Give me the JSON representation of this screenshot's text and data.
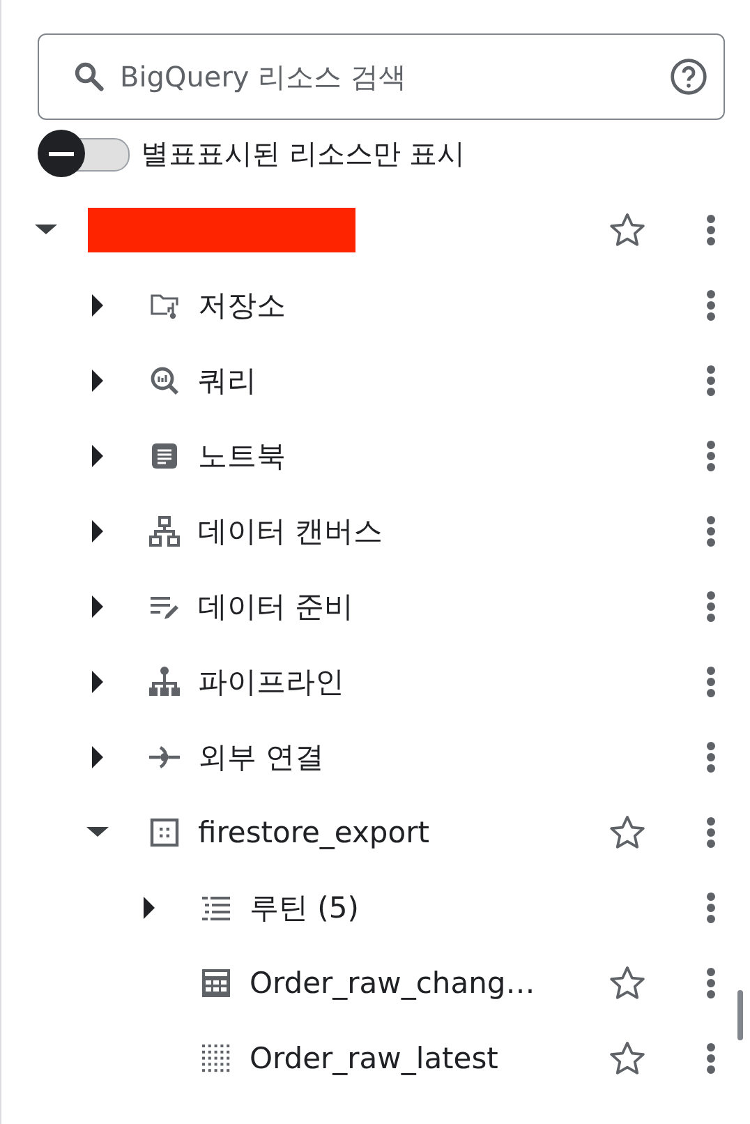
{
  "search": {
    "placeholder": "BigQuery 리소스 검색"
  },
  "starred_filter": {
    "label": "별표표시된 리소스만 표시",
    "on": false
  },
  "tree": [
    {
      "redacted": true,
      "expanded": true,
      "starred": false,
      "children": [
        {
          "label": "저장소",
          "kind": "repository",
          "expanded": false
        },
        {
          "label": "쿼리",
          "kind": "query",
          "expanded": false
        },
        {
          "label": "노트북",
          "kind": "notebook",
          "expanded": false
        },
        {
          "label": "데이터 캔버스",
          "kind": "canvas",
          "expanded": false
        },
        {
          "label": "데이터 준비",
          "kind": "prep",
          "expanded": false
        },
        {
          "label": "파이프라인",
          "kind": "pipeline",
          "expanded": false
        },
        {
          "label": "외부 연결",
          "kind": "connection",
          "expanded": false
        },
        {
          "label": "firestore_export",
          "kind": "dataset",
          "expanded": true,
          "starred": false,
          "children": [
            {
              "label": "루틴 (5)",
              "kind": "routines",
              "expanded": false
            },
            {
              "label": "Order_raw_chang…",
              "kind": "table",
              "starred": false
            },
            {
              "label": "Order_raw_latest",
              "kind": "view",
              "starred": false
            }
          ]
        }
      ]
    }
  ]
}
